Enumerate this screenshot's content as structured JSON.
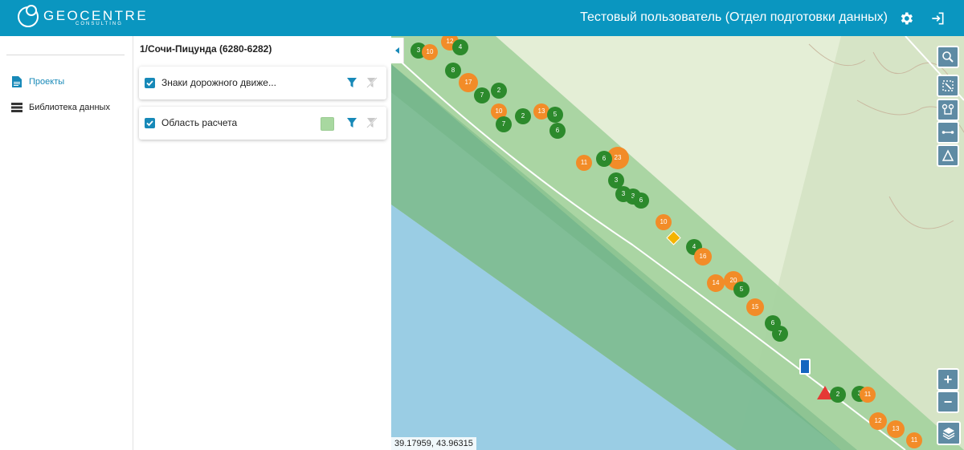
{
  "header": {
    "logo_text": "GEOCENTRE",
    "logo_sub": "CONSULTING",
    "user": "Тестовый пользователь (Отдел подготовки данных)"
  },
  "nav": {
    "projects": "Проекты",
    "library": "Библиотека данных"
  },
  "project": {
    "title": "1/Сочи-Пицунда (6280-6282)",
    "layers": [
      {
        "label": "Знаки дорожного движе..."
      },
      {
        "label": "Область расчета",
        "swatch": "#a8d8a0"
      }
    ]
  },
  "map": {
    "coords": "39.17959, 43.96315",
    "zoom_in": "+",
    "zoom_out": "−",
    "clusters": [
      "12",
      "4",
      "3",
      "10",
      "17",
      "8",
      "2",
      "7",
      "10",
      "13",
      "5",
      "7",
      "2",
      "6",
      "23",
      "6",
      "11",
      "3",
      "3",
      "3",
      "6",
      "10",
      "4",
      "16",
      "14",
      "20",
      "5",
      "15",
      "6",
      "7",
      "3",
      "2",
      "11",
      "12",
      "13",
      "11"
    ]
  },
  "colors": {
    "header": "#0a96c0",
    "accent": "#1789b8",
    "sea": "#9acde4",
    "land": "#d8e9c6",
    "cluster_green": "#2c8a2c",
    "cluster_orange": "#f28c28"
  }
}
